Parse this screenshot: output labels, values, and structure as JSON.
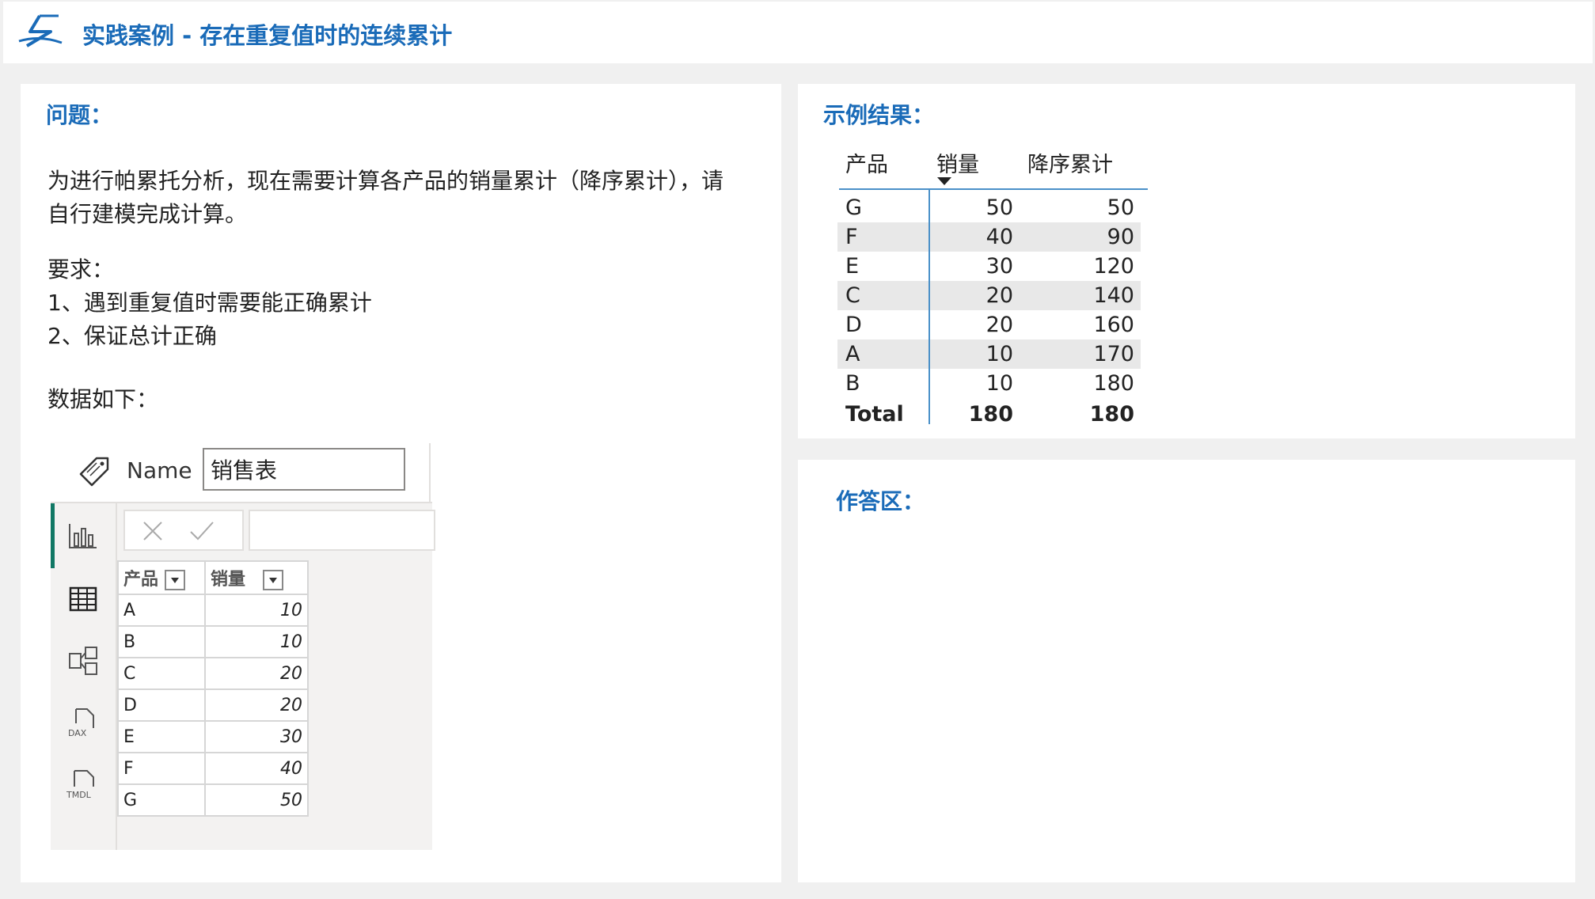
{
  "header": {
    "title": "实践案例 - 存在重复值时的连续累计",
    "logo_icon": "pen-swoosh-logo-icon"
  },
  "problem": {
    "heading": "问题：",
    "text_line1": "为进行帕累托分析，现在需要计算各产品的销量累计（降序累计），请",
    "text_line2": "自行建模完成计算。",
    "req_heading": "要求：",
    "req1": "1、遇到重复值时需要能正确累计",
    "req2": "2、保证总计正确",
    "data_intro": "数据如下："
  },
  "pbi": {
    "name_label": "Name",
    "name_value": "销售表",
    "rail_icons": [
      "report-view-icon",
      "table-view-icon",
      "model-view-icon",
      "dax-query-view-icon",
      "tmdl-view-icon"
    ],
    "columns": [
      "产品",
      "销量"
    ],
    "rows": [
      [
        "A",
        "10"
      ],
      [
        "B",
        "10"
      ],
      [
        "C",
        "20"
      ],
      [
        "D",
        "20"
      ],
      [
        "E",
        "30"
      ],
      [
        "F",
        "40"
      ],
      [
        "G",
        "50"
      ]
    ]
  },
  "result": {
    "heading": "示例结果：",
    "columns": [
      "产品",
      "销量",
      "降序累计"
    ],
    "rows": [
      [
        "G",
        "50",
        "50"
      ],
      [
        "F",
        "40",
        "90"
      ],
      [
        "E",
        "30",
        "120"
      ],
      [
        "C",
        "20",
        "140"
      ],
      [
        "D",
        "20",
        "160"
      ],
      [
        "A",
        "10",
        "170"
      ],
      [
        "B",
        "10",
        "180"
      ]
    ],
    "total": [
      "Total",
      "180",
      "180"
    ]
  },
  "answer": {
    "heading": "作答区："
  }
}
